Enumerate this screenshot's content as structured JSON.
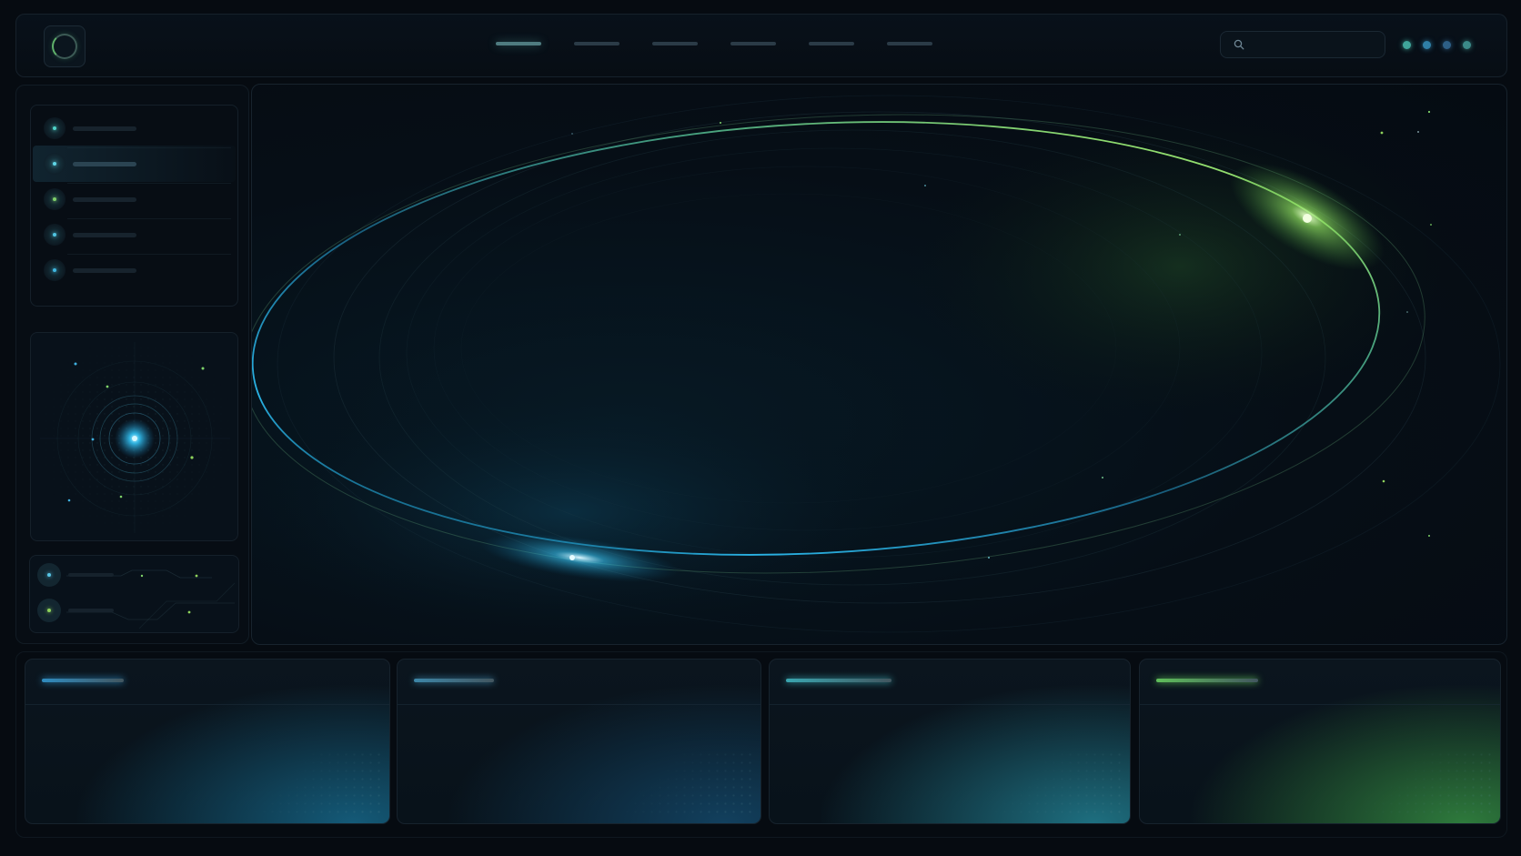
{
  "app": {
    "accent_blue": "#2aa8d8",
    "accent_green": "#6fce5a",
    "background": "#060b11"
  },
  "header": {
    "logo_icon": "ring-logo-icon",
    "nav_tabs": [
      {
        "label": "",
        "active": true
      },
      {
        "label": "",
        "active": false
      },
      {
        "label": "",
        "active": false
      },
      {
        "label": "",
        "active": false
      },
      {
        "label": "",
        "active": false
      },
      {
        "label": "",
        "active": false
      }
    ],
    "search": {
      "placeholder": "",
      "value": "",
      "icon": "search-icon"
    },
    "status_dots": [
      "#3fa59a",
      "#2f7fa6",
      "#2d5f86",
      "#3b8a88"
    ]
  },
  "sidebar": {
    "menu_items": [
      {
        "label": "",
        "dot_color": "#4fd3c8",
        "active": false
      },
      {
        "label": "",
        "dot_color": "#5fd6e6",
        "active": true
      },
      {
        "label": "",
        "dot_color": "#7fcf6a",
        "active": false
      },
      {
        "label": "",
        "dot_color": "#4fc4e0",
        "active": false
      },
      {
        "label": "",
        "dot_color": "#3fb6e0",
        "active": false
      }
    ],
    "radar_icon": "radar-icon",
    "mini_rows": [
      {
        "label": "",
        "dot_color": "#58c6e6"
      },
      {
        "label": "",
        "dot_color": "#8fd35c"
      }
    ]
  },
  "main": {
    "visual": "orbit-visual"
  },
  "cards": [
    {
      "title": "",
      "bar_color": "#2f8cc0",
      "glow": "#145a78"
    },
    {
      "title": "",
      "bar_color": "#3d86a8",
      "glow": "#12405e"
    },
    {
      "title": "",
      "bar_color": "#3aa6b0",
      "glow": "#1e6f80"
    },
    {
      "title": "",
      "bar_color": "#5fbf5a",
      "glow": "#2e7a3c"
    }
  ]
}
